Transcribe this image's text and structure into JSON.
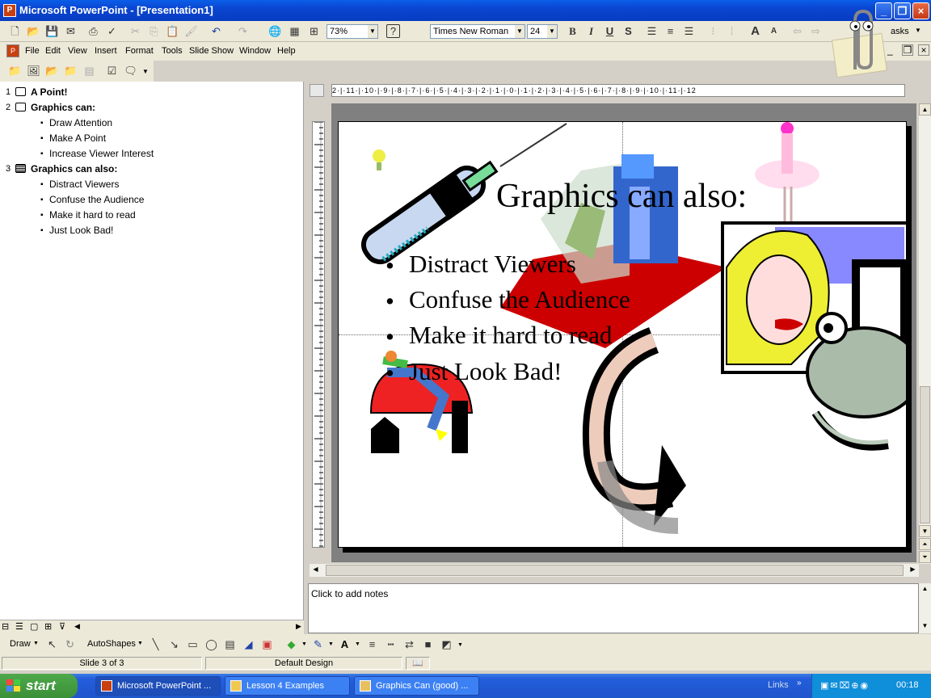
{
  "window": {
    "title": "Microsoft PowerPoint - [Presentation1]",
    "app_icon_letter": "P"
  },
  "toolbar": {
    "zoom": "73%",
    "font_name": "Times New Roman",
    "font_size": "24",
    "bold": "B",
    "italic": "I",
    "underline": "U",
    "shadow": "S",
    "tasks_label": "asks"
  },
  "menu": [
    "File",
    "Edit",
    "View",
    "Insert",
    "Format",
    "Tools",
    "Slide Show",
    "Window",
    "Help"
  ],
  "outline": {
    "slides": [
      {
        "num": "1",
        "title": "A Point!",
        "bullets": []
      },
      {
        "num": "2",
        "title": "Graphics can:",
        "bullets": [
          "Draw Attention",
          "Make A Point",
          "Increase Viewer Interest"
        ]
      },
      {
        "num": "3",
        "title": "Graphics can also:",
        "bullets": [
          "Distract Viewers",
          "Confuse the Audience",
          "Make it hard to read",
          "Just Look Bad!"
        ]
      }
    ]
  },
  "ruler": {
    "h_text": "2·|·11·|·10·|·9·|·8·|·7·|·6·|·5·|·4·|·3·|·2·|·1·|·0·|·1·|·2·|·3·|·4·|·5·|·6·|·7·|·8·|·9·|·10·|·11·|·12"
  },
  "slide": {
    "title": "Graphics can also:",
    "bullets": [
      "Distract Viewers",
      "Confuse the Audience",
      "Make it hard to read",
      "Just Look Bad!"
    ]
  },
  "notes": {
    "placeholder": "Click to add notes"
  },
  "drawbar": {
    "draw_label": "Draw",
    "autoshapes_label": "AutoShapes"
  },
  "status": {
    "slide": "Slide 3 of 3",
    "design": "Default Design"
  },
  "taskbar": {
    "start": "start",
    "tasks": [
      "Microsoft PowerPoint ...",
      "Lesson 4 Examples",
      "Graphics Can (good) ..."
    ],
    "links": "Links",
    "clock": "00:18"
  },
  "colors": {
    "titlebar": "#0a46d1",
    "taskbar": "#245edb",
    "start": "#3a8f37",
    "tray": "#0f8ed9"
  }
}
